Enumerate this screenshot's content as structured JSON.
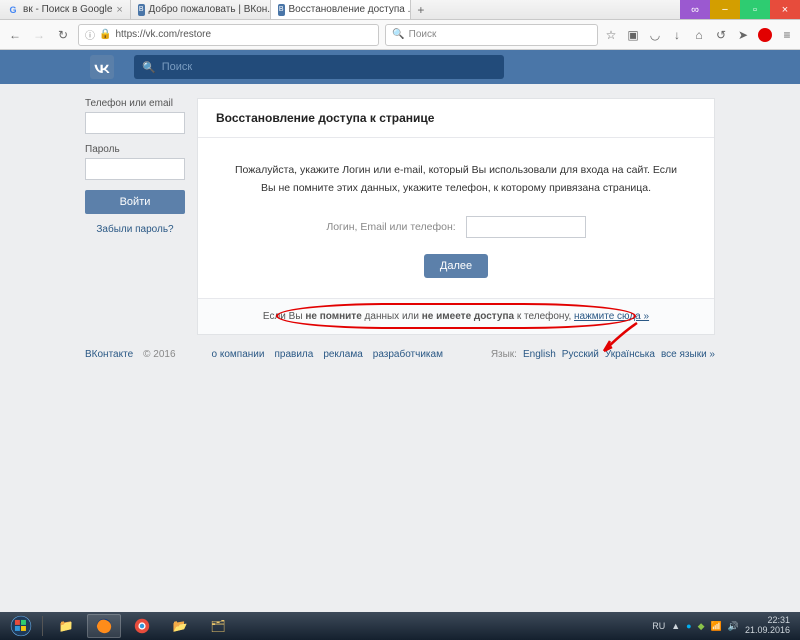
{
  "browser": {
    "tabs": [
      {
        "favicon": "G",
        "title": "вк - Поиск в Google"
      },
      {
        "favicon": "VK",
        "title": "Добро пожаловать | ВКон..."
      },
      {
        "favicon": "VK",
        "title": "Восстановление доступа ..."
      }
    ],
    "url": "https://vk.com/restore",
    "search_placeholder": "Поиск"
  },
  "vk": {
    "search_placeholder": "Поиск",
    "side": {
      "login_label": "Телефон или email",
      "pass_label": "Пароль",
      "login_btn": "Войти",
      "forgot": "Забыли пароль?"
    },
    "main": {
      "title": "Восстановление доступа к странице",
      "instr_l1": "Пожалуйста, укажите Логин или e-mail, который Вы использовали для входа на сайт. Если",
      "instr_l2": "Вы не помните этих данных, укажите телефон, к которому привязана страница.",
      "form_label": "Логин, Email или телефон:",
      "next_btn": "Далее",
      "bottom_a": "Если Вы ",
      "bottom_b": "не помните",
      "bottom_c": " данных или ",
      "bottom_d": "не имеете доступа",
      "bottom_e": " к телефону, ",
      "bottom_link": "нажмите сюда »"
    },
    "footer": {
      "brand": "ВКонтакте",
      "year": "© 2016",
      "about": "о компании",
      "rules": "правила",
      "ads": "реклама",
      "devs": "разработчикам",
      "lang_label": "Язык:",
      "en": "English",
      "ru": "Русский",
      "ua": "Українська",
      "all": "все языки »"
    }
  },
  "tray": {
    "lang": "RU",
    "time": "22:31",
    "date": "21.09.2016"
  }
}
